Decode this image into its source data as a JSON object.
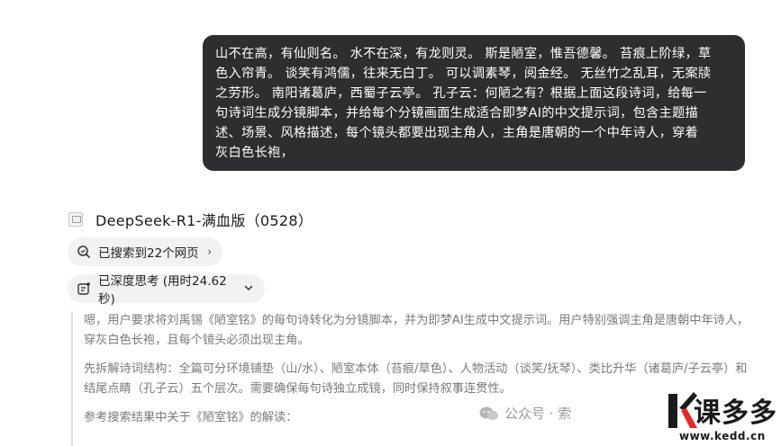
{
  "prompt": {
    "lines": [
      "山不在高，有仙则名。 水不在深，有龙则灵。 斯是陋室，惟吾德馨。 苔痕上阶绿，草",
      "色入帘青。 谈笑有鸿儒，往来无白丁。 可以调素琴，阅金经。 无丝竹之乱耳，无案牍",
      "之劳形。 南阳诸葛庐，西蜀子云亭。 孔子云：何陋之有？根据上面这段诗词，给每一",
      "句诗词生成分镜脚本，并给每个分镜画面生成适合即梦AI的中文提示词，包含主题描",
      "述、场景、风格描述，每个镜头都要出现主角人，主角是唐朝的一个中年诗人，穿着",
      "灰白色长袍，"
    ]
  },
  "model": {
    "name": "DeepSeek-R1-满血版（0528）",
    "icon": "broken-image-icon"
  },
  "search_pill": {
    "label": "已搜索到22个网页",
    "icon": "search-icon",
    "chevron": "›"
  },
  "think_pill": {
    "label": "已深度思考 (用时24.62秒)",
    "icon": "think-icon",
    "chevron": "⌄"
  },
  "thinking": {
    "paragraphs": [
      "嗯，用户要求将刘禹锡《陋室铭》的每句诗转化为分镜脚本，并为即梦AI生成中文提示词。用户特别强调主角是唐朝中年诗人，穿灰白色长袍，且每个镜头必须出现主角。",
      "先拆解诗词结构：全篇可分环境铺垫（山/水）、陋室本体（苔痕/草色）、人物活动（谈笑/抚琴）、类比升华（诸葛庐/子云亭）和结尾点睛（孔子云）五个层次。需要确保每句诗独立成镜，同时保持叙事连贯性。",
      "参考搜索结果中关于《陋室铭》的解读："
    ]
  },
  "watermarks": {
    "wechat_text": "公众号 · 索",
    "logo_text": "课多多",
    "logo_url": "www.kedd.cn"
  }
}
